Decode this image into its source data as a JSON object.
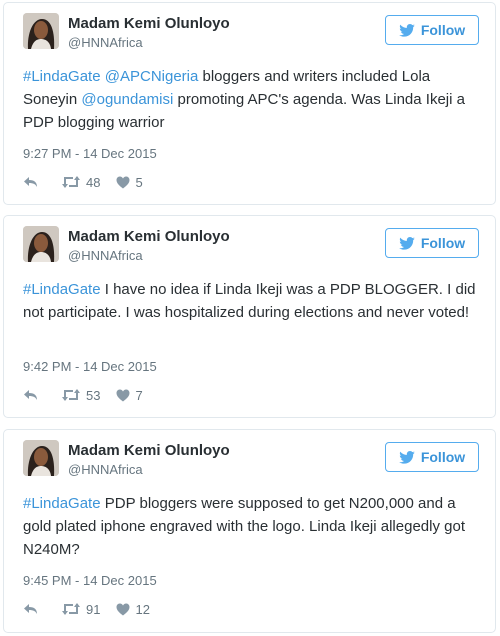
{
  "colors": {
    "accent": "#3b94d9",
    "muted": "#66757f",
    "text": "#292f33",
    "border": "#e1e8ed"
  },
  "tweets": [
    {
      "name": "Madam Kemi Olunloyo",
      "handle": "@HNNAfrica",
      "follow_label": "Follow",
      "text_parts": [
        {
          "text": "#LindaGate",
          "link": true
        },
        {
          "text": " ",
          "link": false
        },
        {
          "text": "@APCNigeria",
          "link": true
        },
        {
          "text": " bloggers and writers included Lola Soneyin ",
          "link": false
        },
        {
          "text": "@ogundamisi",
          "link": true
        },
        {
          "text": " promoting APC's agenda. Was Linda Ikeji a PDP blogging warrior",
          "link": false
        }
      ],
      "time": "9:27 PM - 14 Dec 2015",
      "retweets": "48",
      "likes": "5"
    },
    {
      "name": "Madam Kemi Olunloyo",
      "handle": "@HNNAfrica",
      "follow_label": "Follow",
      "text_parts": [
        {
          "text": "#LindaGate",
          "link": true
        },
        {
          "text": " I have no idea if Linda Ikeji was a PDP BLOGGER. I did not participate. I was hospitalized during elections and never voted!",
          "link": false
        }
      ],
      "time": "9:42 PM - 14 Dec 2015",
      "retweets": "53",
      "likes": "7"
    },
    {
      "name": "Madam Kemi Olunloyo",
      "handle": "@HNNAfrica",
      "follow_label": "Follow",
      "text_parts": [
        {
          "text": "#LindaGate",
          "link": true
        },
        {
          "text": " PDP bloggers were supposed to get N200,000 and a gold plated iphone engraved with the logo. Linda Ikeji allegedly got N240M?",
          "link": false
        }
      ],
      "time": "9:45 PM - 14 Dec 2015",
      "retweets": "91",
      "likes": "12"
    }
  ]
}
